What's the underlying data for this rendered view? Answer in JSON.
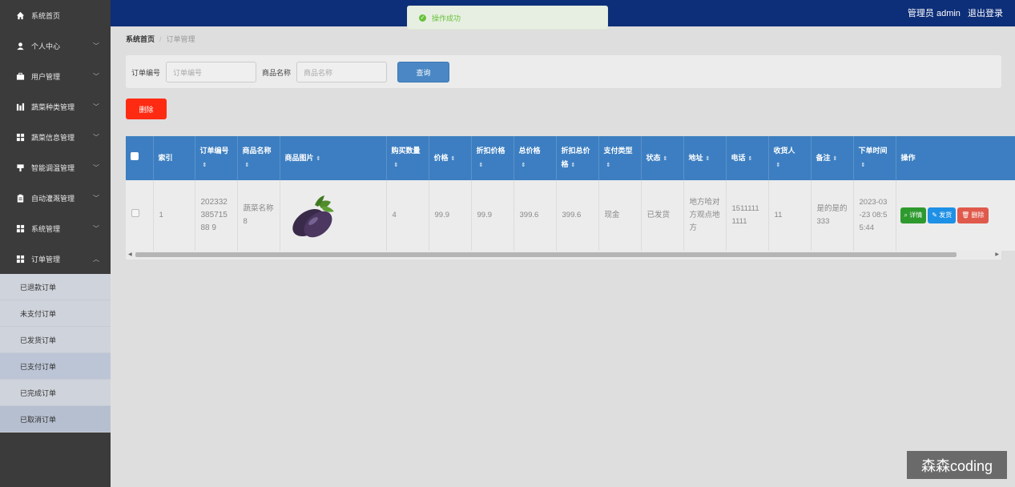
{
  "sidebar": {
    "items": [
      {
        "label": "系统首页",
        "icon": "home-icon",
        "chevron": ""
      },
      {
        "label": "个人中心",
        "icon": "user-icon",
        "chevron": "﹀"
      },
      {
        "label": "用户管理",
        "icon": "briefcase-icon",
        "chevron": "﹀"
      },
      {
        "label": "蔬菜种类管理",
        "icon": "chart-icon",
        "chevron": "﹀"
      },
      {
        "label": "蔬菜信息管理",
        "icon": "grid-icon",
        "chevron": "﹀"
      },
      {
        "label": "智能调温管理",
        "icon": "thermometer-icon",
        "chevron": "﹀"
      },
      {
        "label": "自动灌溉管理",
        "icon": "clipboard-icon",
        "chevron": "﹀"
      },
      {
        "label": "系统管理",
        "icon": "grid-icon",
        "chevron": "﹀"
      },
      {
        "label": "订单管理",
        "icon": "grid-icon",
        "chevron": "︿"
      }
    ],
    "sub_items": [
      "已退款订单",
      "未支付订单",
      "已发货订单",
      "已支付订单",
      "已完成订单",
      "已取消订单"
    ]
  },
  "header": {
    "user_label": "管理员 admin",
    "logout": "退出登录"
  },
  "toast": {
    "message": "操作成功"
  },
  "breadcrumb": {
    "home": "系统首页",
    "current": "订单管理"
  },
  "search": {
    "order_no_label": "订单编号",
    "order_no_placeholder": "订单编号",
    "product_label": "商品名称",
    "product_placeholder": "商品名称",
    "query_button": "查询"
  },
  "delete_button": "删除",
  "table": {
    "headers": [
      "索引",
      "订单编号",
      "商品名称",
      "商品图片",
      "购买数量",
      "价格",
      "折扣价格",
      "总价格",
      "折扣总价格",
      "支付类型",
      "状态",
      "地址",
      "电话",
      "收货人",
      "备注",
      "下单时间",
      "操作"
    ],
    "rows": [
      {
        "index": "1",
        "order_no": "20233238571588 9",
        "product_name": "蔬菜名称8",
        "quantity": "4",
        "price": "99.9",
        "discount_price": "99.9",
        "total_price": "399.6",
        "discount_total": "399.6",
        "pay_type": "现金",
        "status": "已发货",
        "address": "地方哈对方观点地方",
        "phone": "15111111111",
        "receiver": "11",
        "remark": "是的是的333",
        "order_time": "2023-03-23 08:55:44"
      }
    ],
    "actions": {
      "detail": "详情",
      "ship": "发货",
      "delete": "删除"
    }
  },
  "watermark": "森森coding",
  "colors": {
    "topbar": "#0d2e78",
    "table_header": "#3c7ec1",
    "delete": "#ff2a12",
    "detail": "#2e9a2e",
    "ship": "#1e90e6"
  }
}
